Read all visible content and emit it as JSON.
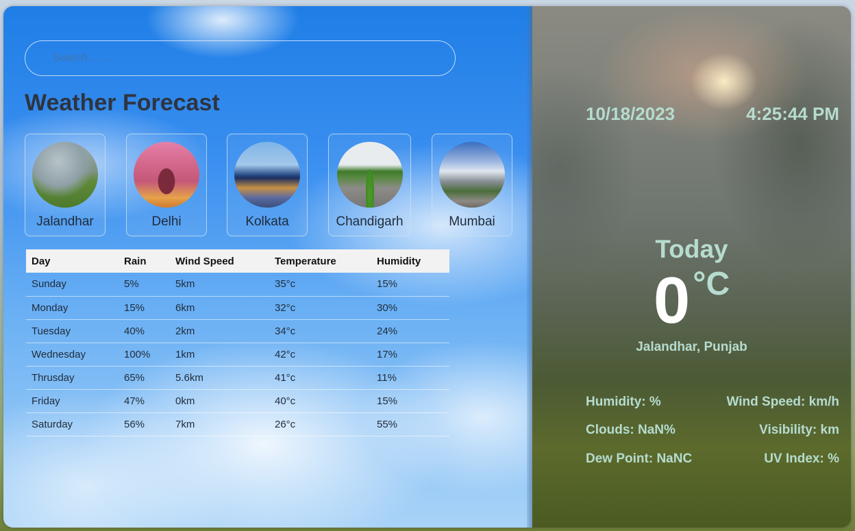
{
  "search": {
    "placeholder": "Search........"
  },
  "title": "Weather Forecast",
  "cities": [
    {
      "name": "Jalandhar",
      "image": "Jalandhar photo"
    },
    {
      "name": "Delhi",
      "image": "India Gate photo"
    },
    {
      "name": "Kolkata",
      "image": "Howrah Bridge photo"
    },
    {
      "name": "Chandigarh",
      "image": "tree-lined road photo"
    },
    {
      "name": "Mumbai",
      "image": "Marine Drive photo"
    }
  ],
  "forecast": {
    "headers": [
      "Day",
      "Rain",
      "Wind Speed",
      "Temperature",
      "Humidity"
    ],
    "rows": [
      [
        "Sunday",
        "5%",
        "5km",
        "35°c",
        "15%"
      ],
      [
        "Monday",
        "15%",
        "6km",
        "32°c",
        "30%"
      ],
      [
        "Tuesday",
        "40%",
        "2km",
        "34°c",
        "24%"
      ],
      [
        "Wednesday",
        "100%",
        "1km",
        "42°c",
        "17%"
      ],
      [
        "Thrusday",
        "65%",
        "5.6km",
        "41°c",
        "11%"
      ],
      [
        "Friday",
        "47%",
        "0km",
        "40°c",
        "15%"
      ],
      [
        "Saturday",
        "56%",
        "7km",
        "26°c",
        "55%"
      ]
    ]
  },
  "current": {
    "date": "10/18/2023",
    "time": "4:25:44 PM",
    "today_label": "Today",
    "temperature": "0",
    "unit": "°C",
    "location": "Jalandhar, Punjab",
    "humidity": "Humidity: %",
    "wind_speed": "Wind Speed: km/h",
    "clouds": "Clouds: NaN%",
    "visibility": "Visibility: km",
    "dew_point": "Dew Point: NaNC",
    "uv_index": "UV Index: %"
  },
  "colors": {
    "accent_text": "#b6dccf",
    "title_text": "#2e3440",
    "sky_blue": "#1f7ee6"
  }
}
